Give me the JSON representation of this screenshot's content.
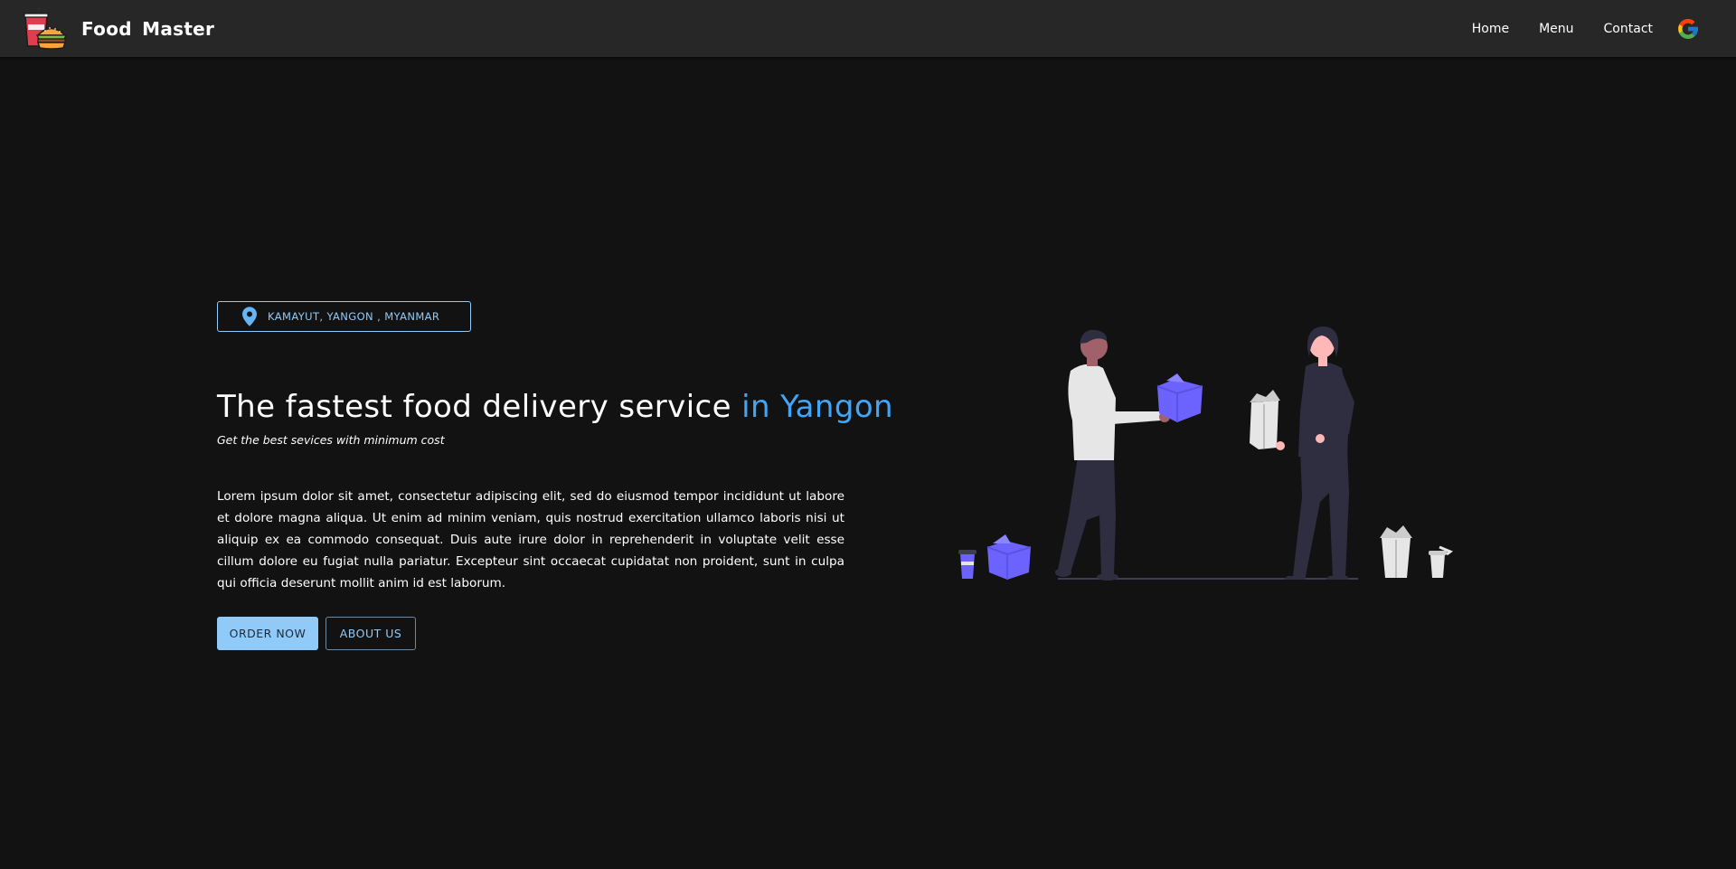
{
  "header": {
    "brand_name": "Food  Master",
    "logo_icon": "fast-food-logo-icon",
    "nav": [
      {
        "label": "Home"
      },
      {
        "label": "Menu"
      },
      {
        "label": "Contact"
      }
    ],
    "google_icon": "google-icon"
  },
  "hero": {
    "location": "KAMAYUT, YANGON , MYANMAR",
    "location_icon": "location-pin-icon",
    "headline_main": "The fastest food delivery service ",
    "headline_accent": "in Yangon",
    "subtitle": "Get the best sevices with minimum cost",
    "body": "Lorem ipsum dolor sit amet, consectetur adipiscing elit, sed do eiusmod tempor incididunt ut labore et dolore magna aliqua. Ut enim ad minim veniam, quis nostrud exercitation ullamco laboris nisi ut aliquip ex ea commodo consequat. Duis aute irure dolor in reprehenderit in voluptate velit esse cillum dolore eu fugiat nulla pariatur. Excepteur sint occaecat cupidatat non proident, sunt in culpa qui officia deserunt mollit anim id est laborum.",
    "order_button": "ORDER NOW",
    "about_button": "ABOUT US",
    "illustration_icon": "food-delivery-illustration"
  },
  "colors": {
    "background": "#121212",
    "navbar": "#272727",
    "accent": "#42a5f5",
    "light_accent": "#90caf9",
    "illustration_purple": "#6c63ff"
  }
}
